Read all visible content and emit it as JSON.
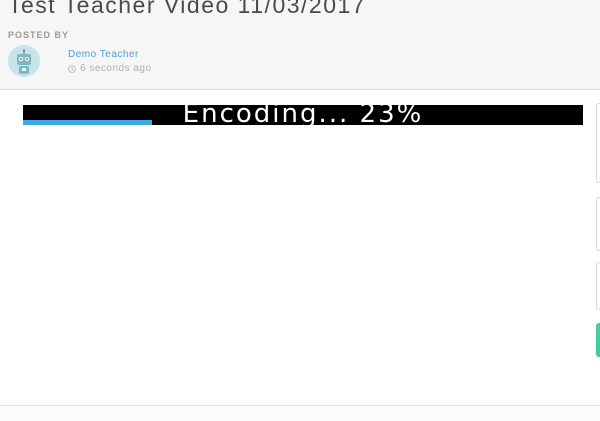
{
  "video": {
    "title": "Test Teacher Video 11/03/2017"
  },
  "post": {
    "posted_by_label": "POSTED BY",
    "author": "Demo Teacher",
    "time_ago": "6 seconds ago",
    "avatar_icon": "robot-avatar-icon",
    "time_icon": "clock-icon"
  },
  "player": {
    "status_text": "Encoding... 23%",
    "encoding_progress": 0.23
  },
  "colors": {
    "accent": "#3fa9e0",
    "author_link": "#4a9ed8",
    "side_tab_active": "#3ecf9a"
  }
}
